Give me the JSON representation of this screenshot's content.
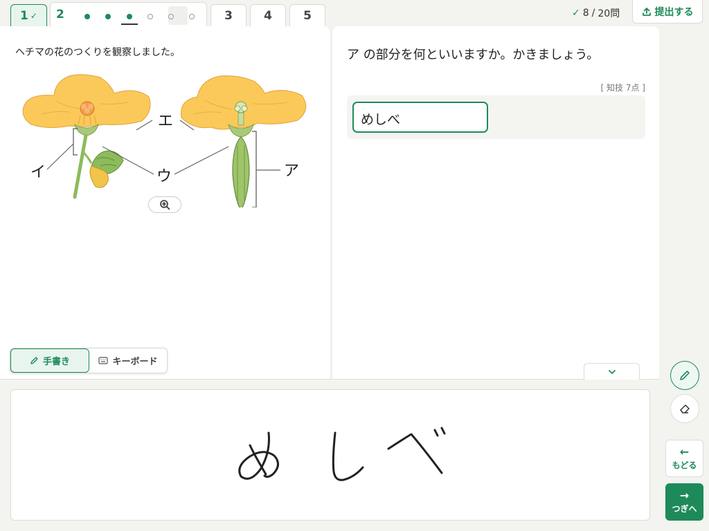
{
  "tabs": [
    {
      "label": "1",
      "status": "done"
    },
    {
      "label": "2"
    },
    {
      "label": "3"
    },
    {
      "label": "4"
    },
    {
      "label": "5"
    }
  ],
  "sub_questions": [
    "filled",
    "filled",
    "filled-current",
    "empty",
    "empty",
    "empty"
  ],
  "progress": {
    "answered": "8",
    "total": "20問"
  },
  "submit_label": "提出する",
  "instruction": "ヘチマの花のつくりを観察しました。",
  "diagram_labels": {
    "a": "ア",
    "i": "イ",
    "u": "ウ",
    "e": "エ"
  },
  "question": "ア の部分を何といいますか。かきましょう。",
  "score": "[ 知技 7点 ]",
  "answer": "めしべ",
  "modes": {
    "handwriting": "手書き",
    "keyboard": "キーボード"
  },
  "handwriting_text": "めしべ",
  "nav": {
    "back": "もどる",
    "next": "つぎへ"
  },
  "colors": {
    "accent": "#1e8a5a",
    "petal": "#fbc95a",
    "stem": "#8cbb5c"
  }
}
